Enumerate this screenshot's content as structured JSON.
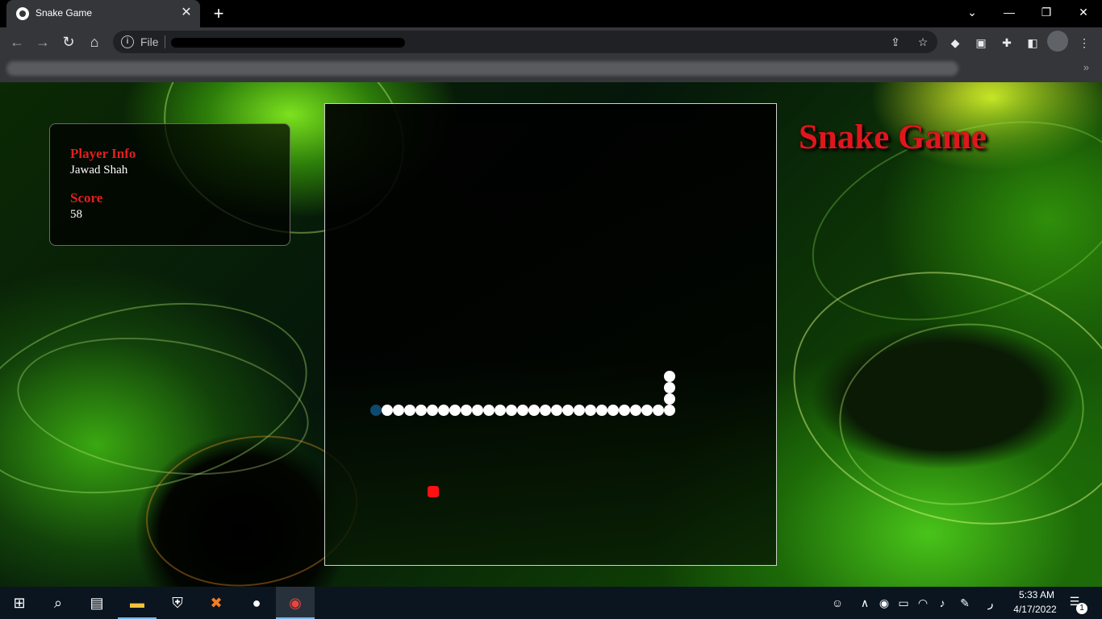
{
  "browser": {
    "tab_title": "Snake Game",
    "new_tab_symbol": "+",
    "close_symbol": "✕",
    "file_label": "File",
    "win_minimize": "—",
    "win_restore": "❐",
    "win_close": "✕",
    "bookmarks_more": "»"
  },
  "page": {
    "title": "Snake Game",
    "player_info_label": "Player Info",
    "player_name": "Jawad Shah",
    "score_label": "Score",
    "score_value": "58"
  },
  "game": {
    "snake_color": "#ffffff",
    "snake_head_color": "#0e4a6e",
    "food_color": "#ff1010",
    "snake_length": 30,
    "food_count": 1
  },
  "taskbar": {
    "time": "5:33 AM",
    "date": "4/17/2022",
    "notification_count": "1",
    "apps": [
      "start-icon",
      "search-icon",
      "task-view-icon",
      "file-explorer-icon",
      "security-icon",
      "xampp-icon",
      "app-icon",
      "chrome-icon"
    ]
  },
  "colors": {
    "title_red": "#e0161d",
    "chrome_dark": "#35363a",
    "taskbar": "#0b1520"
  }
}
